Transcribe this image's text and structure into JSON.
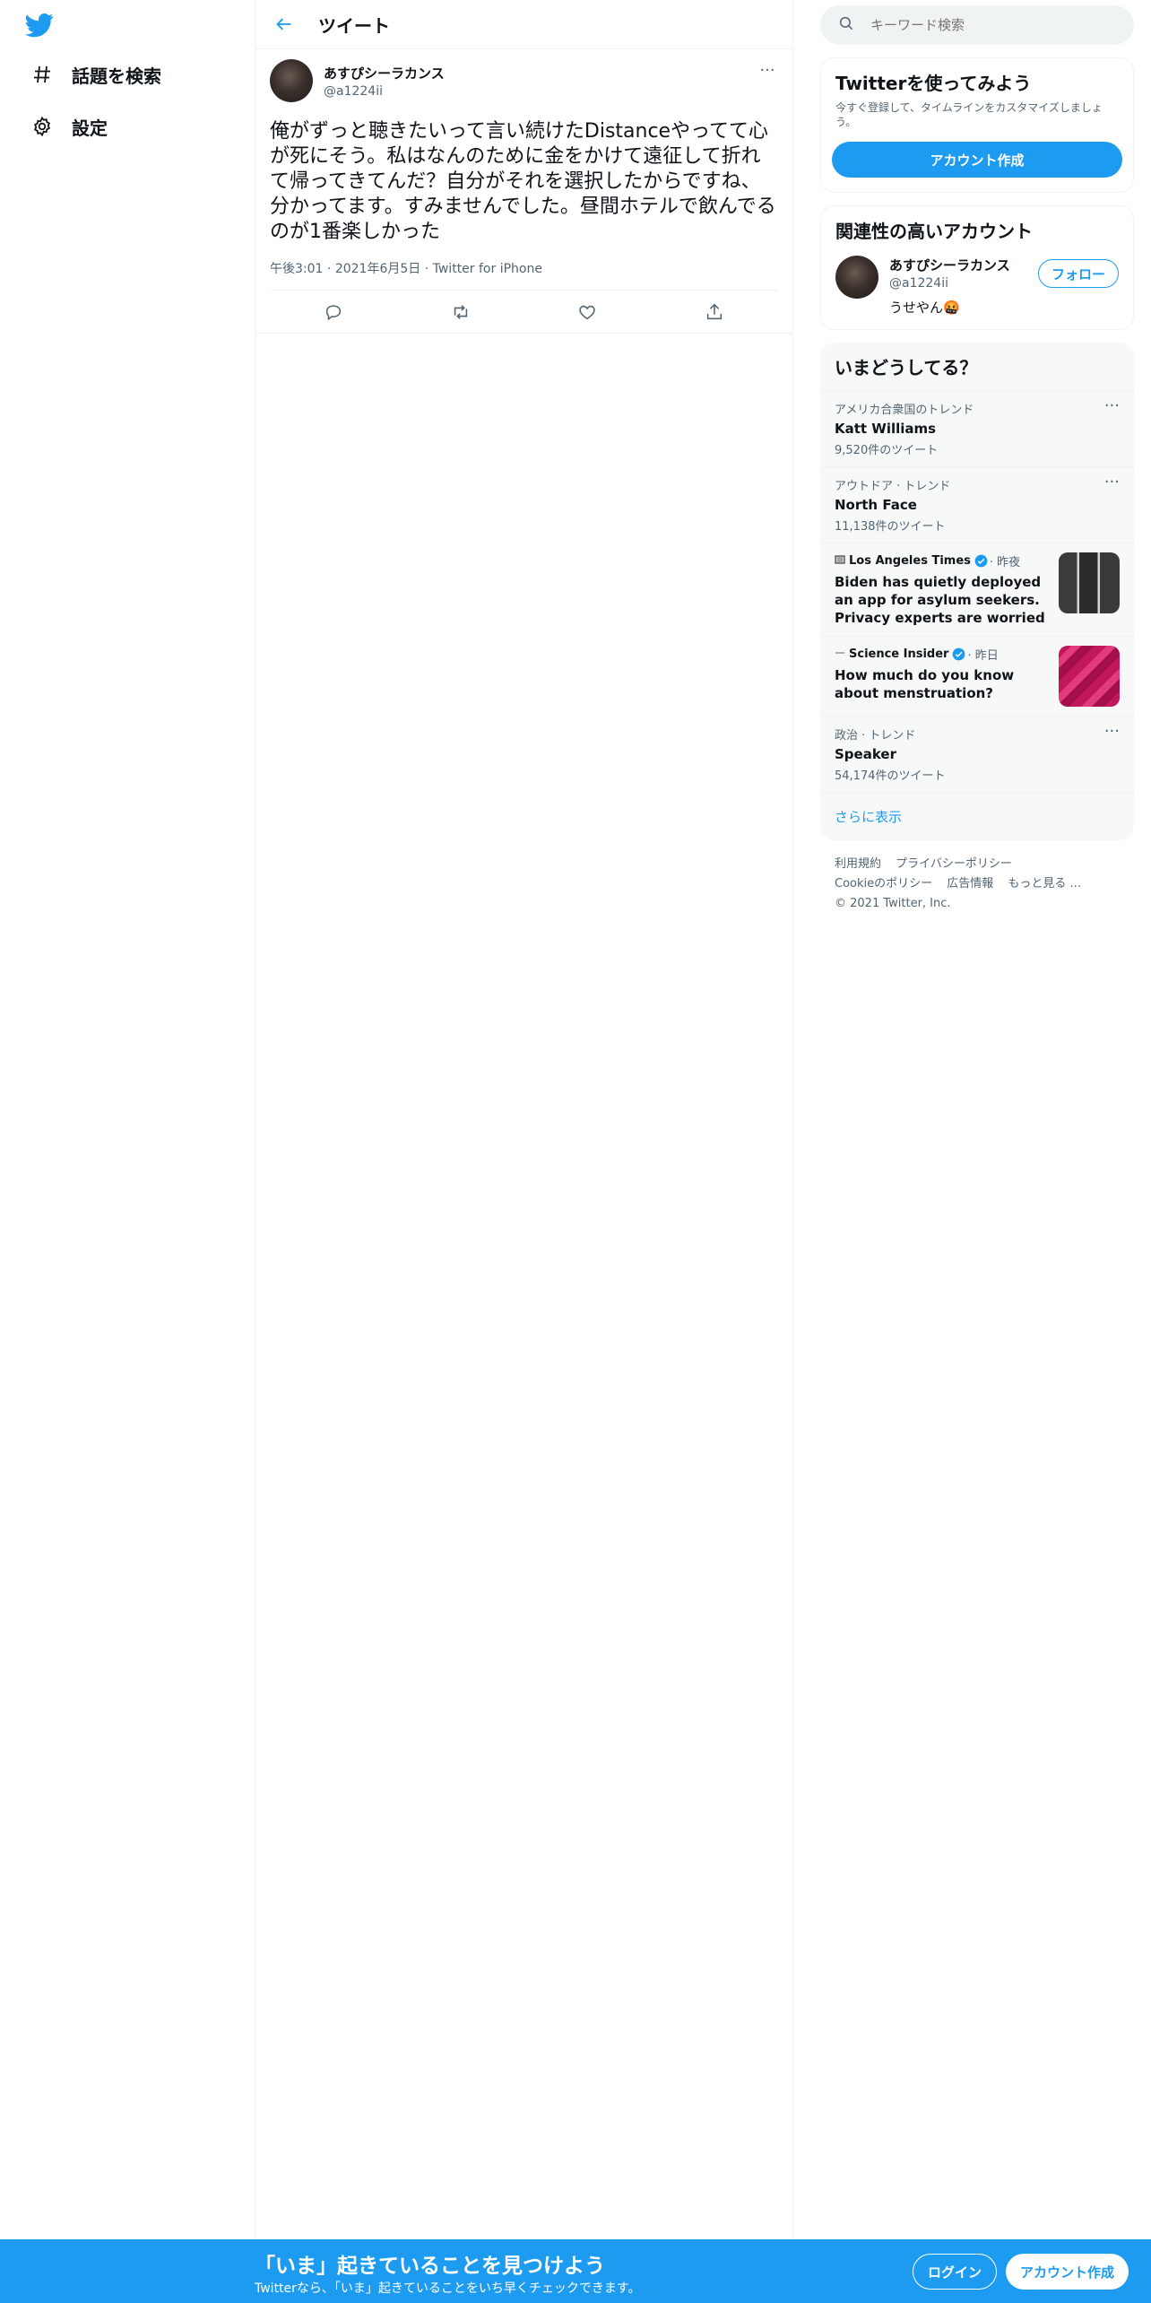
{
  "nav": {
    "logo_icon": "twitter-bird-icon",
    "items": [
      {
        "label": "話題を検索",
        "icon": "hashtag-icon"
      },
      {
        "label": "設定",
        "icon": "gear-icon"
      }
    ]
  },
  "main": {
    "title": "ツイート",
    "tweet": {
      "display_name": "あすぴシーラカンス",
      "handle": "@a1224ii",
      "text": "俺がずっと聴きたいって言い続けたDistanceやってて心が死にそう。私はなんのために金をかけて遠征して折れて帰ってきてんだ？自分がそれを選択したからですね、分かってます。すみませんでした。昼間ホテルで飲んでるのが1番楽しかった",
      "time": "午後3:01",
      "date": "2021年6月5日",
      "source": "Twitter for iPhone"
    }
  },
  "right": {
    "search_placeholder": "キーワード検索",
    "signup_card": {
      "title": "Twitterを使ってみよう",
      "description": "今すぐ登録して、タイムラインをカスタマイズしましょう。",
      "button": "アカウント作成"
    },
    "related": {
      "title": "関連性の高いアカウント",
      "name": "あすぴシーラカンス",
      "handle": "@a1224ii",
      "bio": "うせやん🤬",
      "follow": "フォロー"
    },
    "trends": {
      "title": "いまどうしてる？",
      "items": [
        {
          "context": "アメリカ合衆国のトレンド",
          "name": "Katt Williams",
          "count": "9,520件のツイート"
        },
        {
          "context": "アウトドア · トレンド",
          "name": "North Face",
          "count": "11,138件のツイート"
        },
        {
          "context": "政治 · トレンド",
          "name": "Speaker",
          "count": "54,174件のツイート"
        }
      ],
      "news": [
        {
          "source": "Los Angeles Times",
          "time": "· 昨夜",
          "title": "Biden has quietly deployed an app for asylum seekers. Privacy experts are worried"
        },
        {
          "source": "Science Insider",
          "time": "· 昨日",
          "title": "How much do you know about menstruation?"
        }
      ],
      "show_more": "さらに表示"
    },
    "footer": {
      "links": [
        "利用規約",
        "プライバシーポリシー",
        "Cookieのポリシー",
        "広告情報",
        "もっと見る ..."
      ],
      "copyright": "© 2021 Twitter, Inc."
    }
  },
  "bottom_bar": {
    "title": "「いま」起きていることを見つけよう",
    "subtitle": "Twitterなら、「いま」起きていることをいち早くチェックできます。",
    "login": "ログイン",
    "signup": "アカウント作成"
  },
  "colors": {
    "accent": "#1d9bf0",
    "secondary_text": "#536471",
    "border": "#eff3f4"
  }
}
